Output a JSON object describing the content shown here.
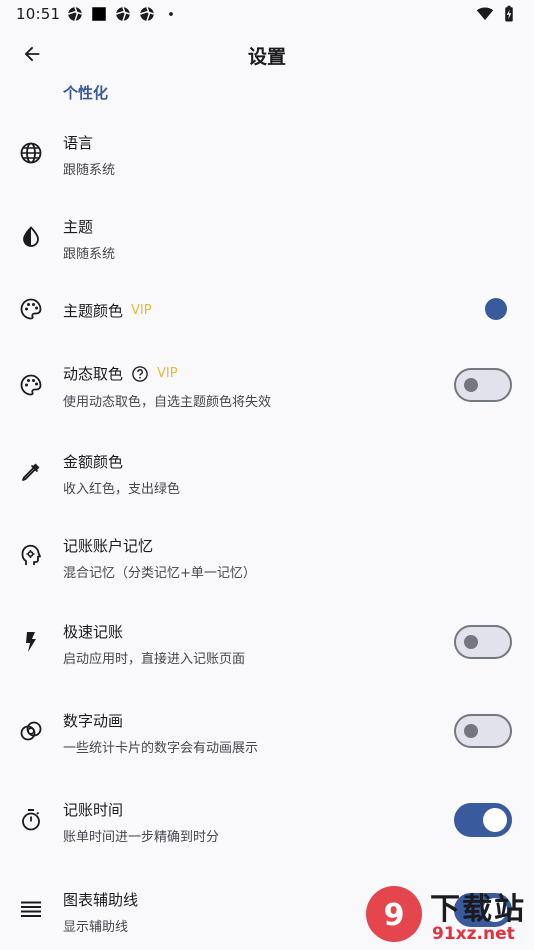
{
  "status_bar": {
    "time": "10:51"
  },
  "app_bar": {
    "title": "设置"
  },
  "section": {
    "label": "个性化"
  },
  "colors": {
    "accent": "#3a5a9e",
    "vip": "#e5b93a"
  },
  "items": [
    {
      "icon": "globe-icon",
      "title": "语言",
      "subtitle": "跟随系统"
    },
    {
      "icon": "contrast-icon",
      "title": "主题",
      "subtitle": "跟随系统"
    },
    {
      "icon": "palette-icon",
      "title": "主题颜色",
      "badge": "VIP",
      "color_value": "#3a5a9e"
    },
    {
      "icon": "palette-icon",
      "title": "动态取色",
      "badge": "VIP",
      "subtitle": "使用动态取色，自选主题颜色将失效",
      "toggle": false
    },
    {
      "icon": "eyedropper-icon",
      "title": "金额颜色",
      "subtitle": "收入红色，支出绿色"
    },
    {
      "icon": "brain-head-icon",
      "title": "记账账户记忆",
      "subtitle": "混合记忆（分类记忆+单一记忆）"
    },
    {
      "icon": "lightning-icon",
      "title": "极速记账",
      "subtitle": "启动应用时，直接进入记账页面",
      "toggle": false
    },
    {
      "icon": "overlapping-circles-icon",
      "title": "数字动画",
      "subtitle": "一些统计卡片的数字会有动画展示",
      "toggle": false
    },
    {
      "icon": "stopwatch-icon",
      "title": "记账时间",
      "subtitle": "账单时间进一步精确到时分",
      "toggle": true
    },
    {
      "icon": "grid-lines-icon",
      "title": "图表辅助线",
      "subtitle": "显示辅助线",
      "toggle": true
    }
  ],
  "watermark": {
    "text": "下载站",
    "domain": "91xz.net"
  }
}
